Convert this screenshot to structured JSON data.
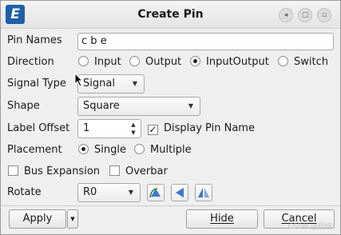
{
  "window": {
    "title": "Create Pin",
    "logo_letter": "E",
    "controls": [
      "◂",
      "▢",
      "▫",
      "✕"
    ]
  },
  "pin_names": {
    "label": "Pin Names",
    "value": "c b e"
  },
  "direction": {
    "label": "Direction",
    "options": [
      "Input",
      "Output",
      "InputOutput",
      "Switch"
    ],
    "selected": "InputOutput"
  },
  "signal_type": {
    "label": "Signal Type",
    "value": "Signal"
  },
  "shape": {
    "label": "Shape",
    "value": "Square"
  },
  "label_offset": {
    "label": "Label Offset",
    "value": "1",
    "display_pin_name_label": "Display Pin Name",
    "display_pin_name_checked": true
  },
  "placement": {
    "label": "Placement",
    "options": [
      "Single",
      "Multiple"
    ],
    "selected": "Single"
  },
  "bus_expansion": {
    "label": "Bus Expansion",
    "checked": false
  },
  "overbar": {
    "label": "Overbar",
    "checked": false
  },
  "rotate": {
    "label": "Rotate",
    "value": "R0"
  },
  "footer": {
    "apply_label": "Apply",
    "hide_label": "Hide",
    "cancel_label": "Cancel"
  },
  "watermark": "CSDN @翔梓"
}
